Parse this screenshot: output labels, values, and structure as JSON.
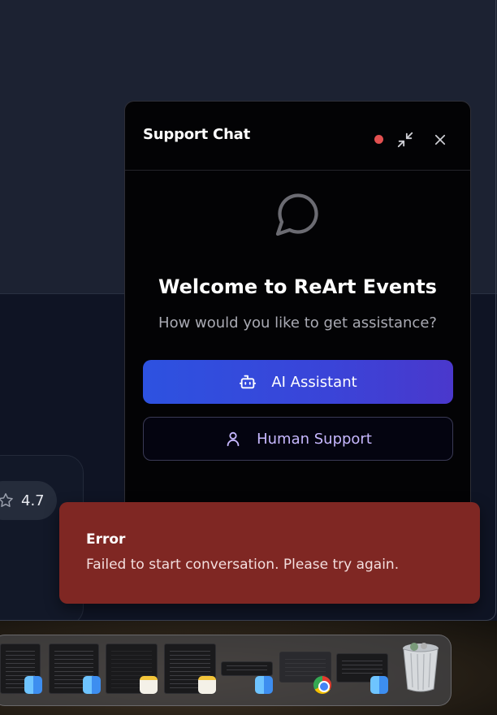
{
  "background": {
    "rating_value": "4.7"
  },
  "chat": {
    "title": "Support Chat",
    "status_color": "#e25050",
    "welcome_title": "Welcome to ReArt Events",
    "subtitle": "How would you like to get assistance?",
    "ai_button_label": "AI Assistant",
    "human_button_label": "Human Support",
    "accent_gradient": [
      "#2d52e0",
      "#4a38cc"
    ]
  },
  "toast": {
    "title": "Error",
    "message": "Failed to start conversation. Please try again.",
    "color": "#7f2723"
  },
  "dock": {
    "items": [
      {
        "kind": "window-thumbnail",
        "badge": "finder-icon"
      },
      {
        "kind": "window-thumbnail",
        "badge": "finder-icon"
      },
      {
        "kind": "window-thumbnail",
        "badge": "notes-icon"
      },
      {
        "kind": "window-thumbnail",
        "badge": "notes-icon"
      },
      {
        "kind": "window-thumbnail",
        "badge": "finder-icon"
      },
      {
        "kind": "window-thumbnail",
        "badge": "chrome-icon"
      },
      {
        "kind": "window-thumbnail",
        "badge": "finder-icon"
      },
      {
        "kind": "app",
        "badge": "trash-icon"
      }
    ]
  }
}
